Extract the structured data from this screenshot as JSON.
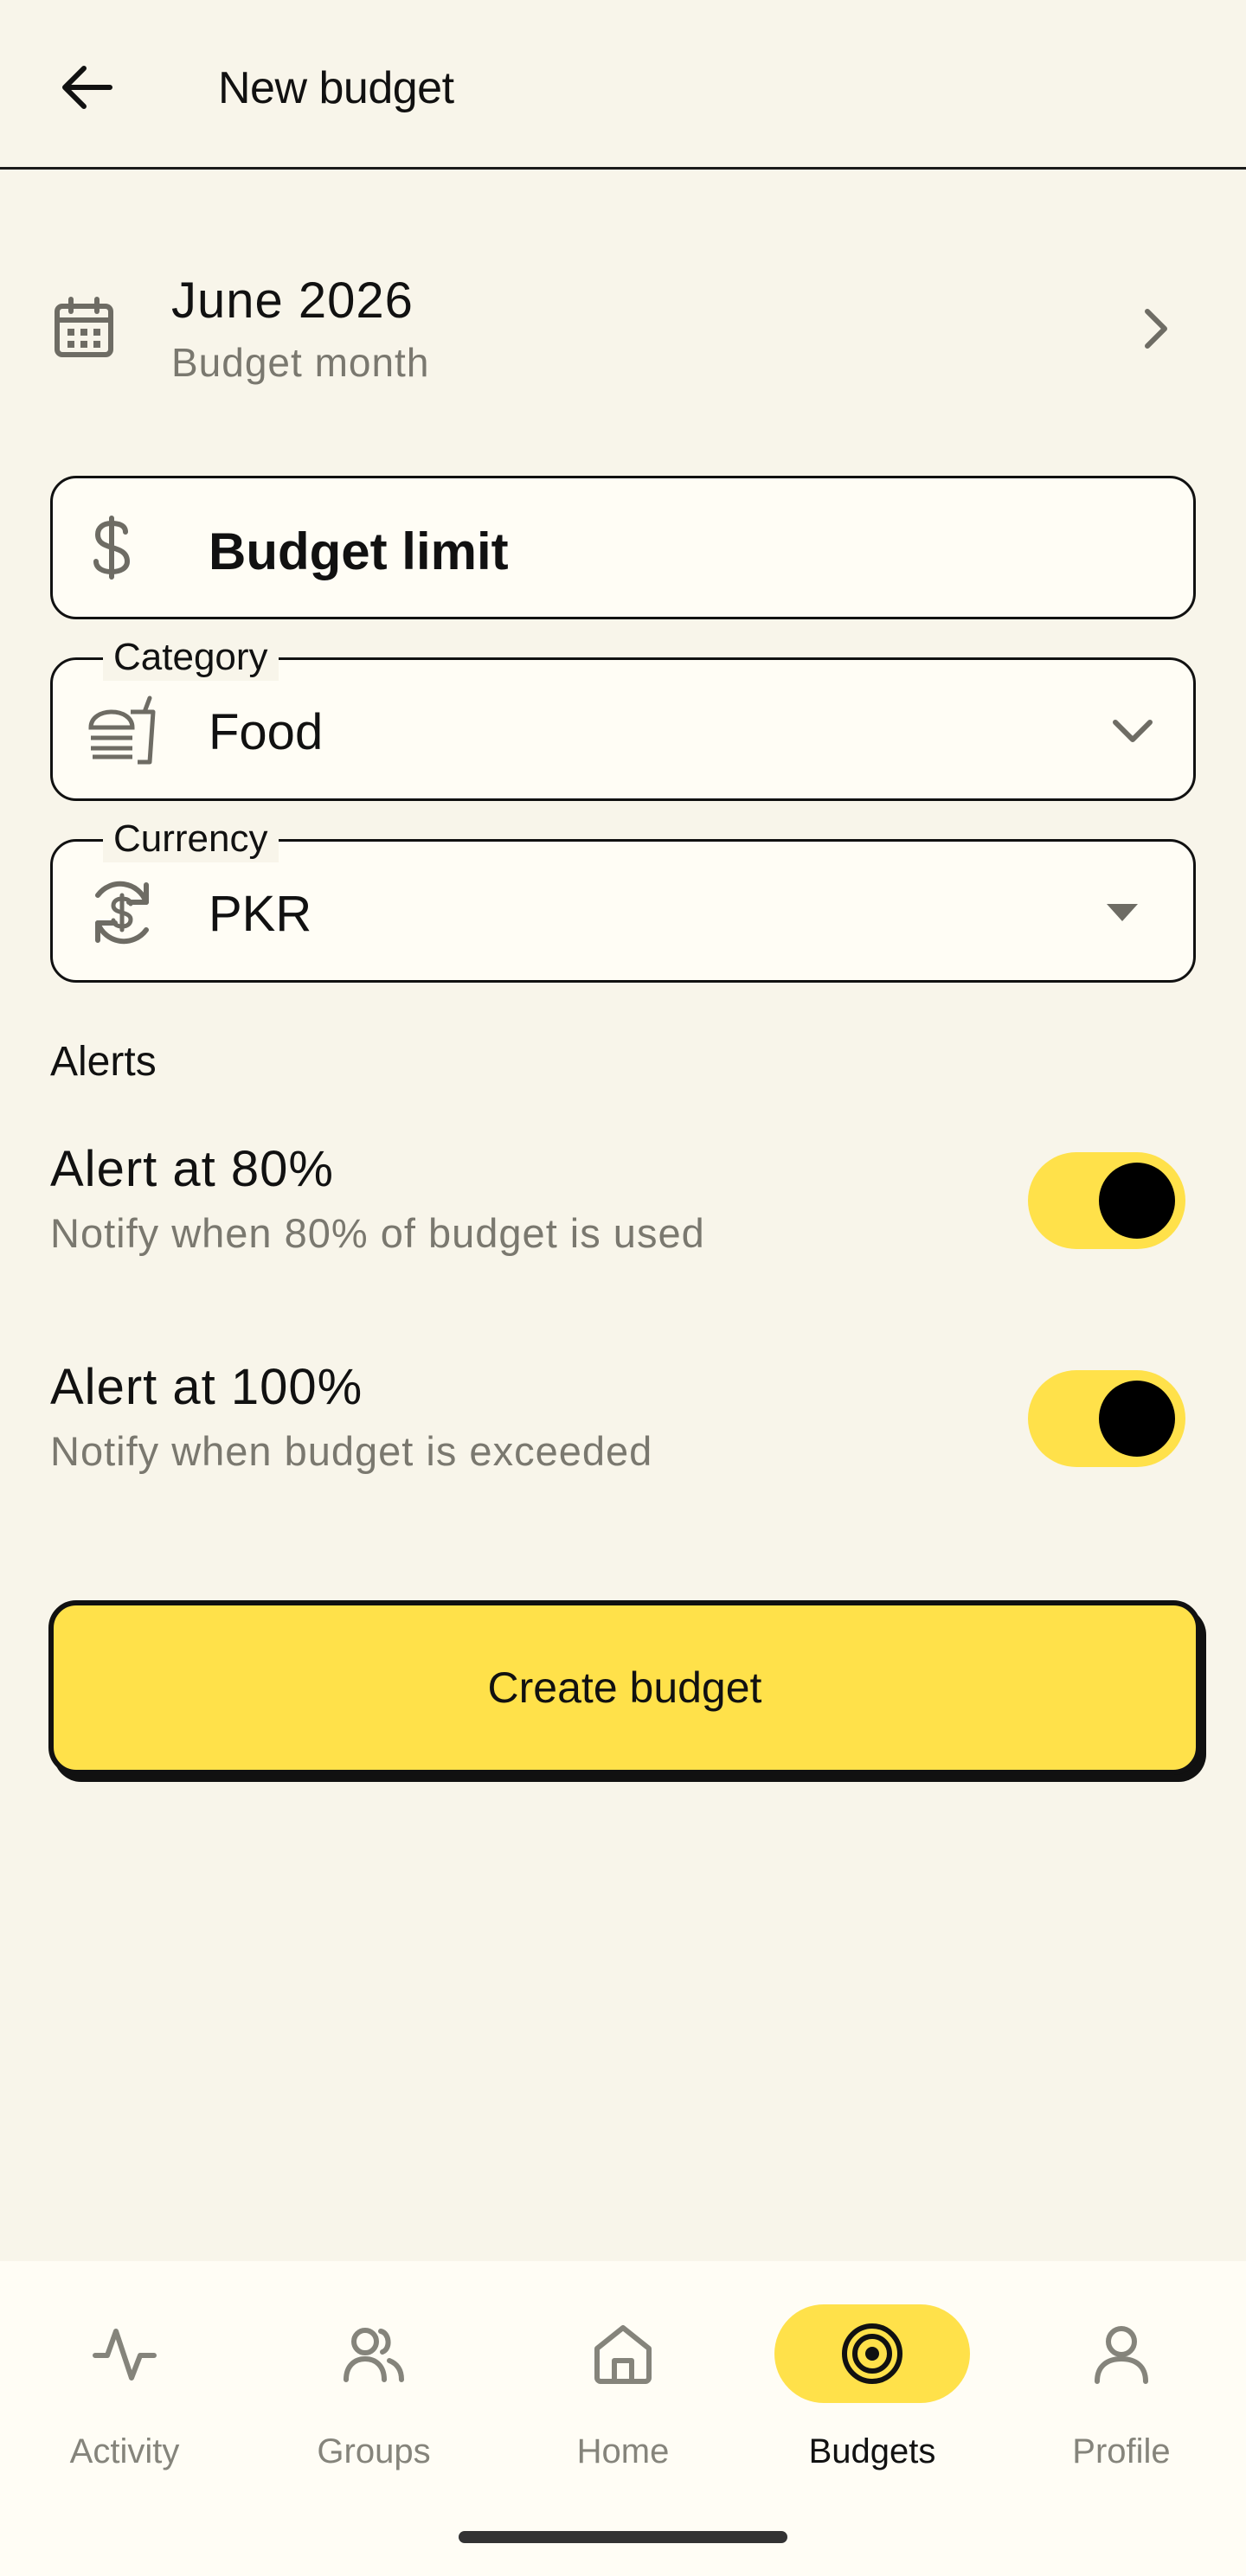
{
  "header": {
    "title": "New budget",
    "back_icon": "arrow-left-icon"
  },
  "month": {
    "value": "June 2026",
    "label": "Budget month",
    "icon": "calendar-icon"
  },
  "fields": {
    "limit": {
      "placeholder": "Budget limit",
      "icon": "dollar-icon"
    },
    "category": {
      "label": "Category",
      "value": "Food",
      "icon": "fastfood-icon"
    },
    "currency": {
      "label": "Currency",
      "value": "PKR",
      "icon": "currency-exchange-icon"
    }
  },
  "alerts": {
    "title": "Alerts",
    "items": [
      {
        "title": "Alert at 80%",
        "desc": "Notify when 80% of budget is used",
        "enabled": true
      },
      {
        "title": "Alert at 100%",
        "desc": "Notify when budget is exceeded",
        "enabled": true
      }
    ]
  },
  "actions": {
    "create_label": "Create budget"
  },
  "nav": {
    "items": [
      {
        "label": "Activity",
        "icon": "activity-pulse-icon",
        "active": false
      },
      {
        "label": "Groups",
        "icon": "groups-icon",
        "active": false
      },
      {
        "label": "Home",
        "icon": "home-icon",
        "active": false
      },
      {
        "label": "Budgets",
        "icon": "target-icon",
        "active": true
      },
      {
        "label": "Profile",
        "icon": "profile-icon",
        "active": false
      }
    ]
  },
  "colors": {
    "background": "#f8f5ea",
    "accent": "#ffe14a",
    "text": "#111111",
    "muted": "#7a786f"
  }
}
